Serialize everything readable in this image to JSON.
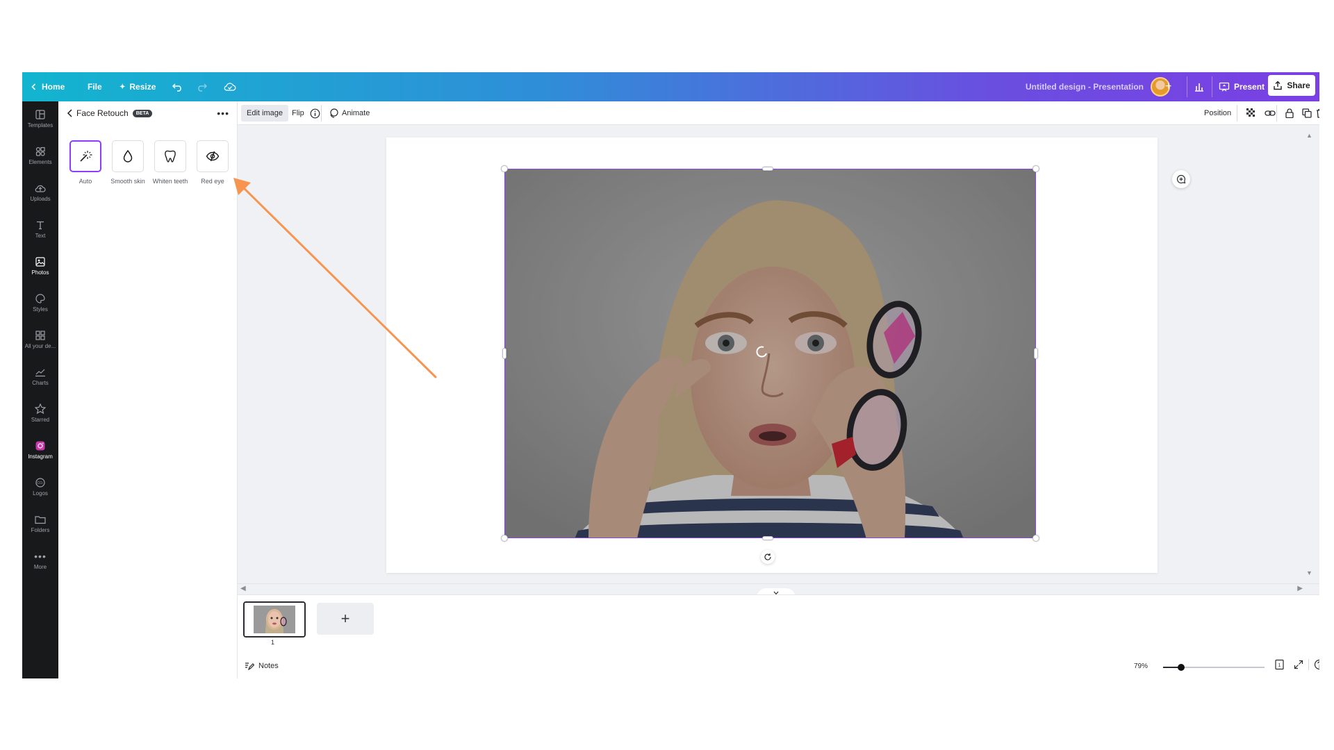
{
  "topbar": {
    "home": "Home",
    "file": "File",
    "resize": "Resize",
    "doc_title": "Untitled design - Presentation",
    "present": "Present",
    "share": "Share"
  },
  "rail": {
    "items": [
      {
        "label": "Templates",
        "icon": "templates-icon"
      },
      {
        "label": "Elements",
        "icon": "elements-icon"
      },
      {
        "label": "Uploads",
        "icon": "upload-cloud-icon"
      },
      {
        "label": "Text",
        "icon": "text-icon"
      },
      {
        "label": "Photos",
        "icon": "photos-icon"
      },
      {
        "label": "Styles",
        "icon": "palette-icon"
      },
      {
        "label": "All your de...",
        "icon": "grid-icon"
      },
      {
        "label": "Charts",
        "icon": "chart-icon"
      },
      {
        "label": "Starred",
        "icon": "star-icon"
      },
      {
        "label": "Instagram",
        "icon": "instagram-icon"
      },
      {
        "label": "Logos",
        "icon": "logo-icon"
      },
      {
        "label": "Folders",
        "icon": "folder-icon"
      },
      {
        "label": "More",
        "icon": "more-icon"
      }
    ],
    "active": "Photos"
  },
  "panel": {
    "title": "Face Retouch",
    "badge": "BETA",
    "tools": [
      {
        "label": "Auto",
        "icon": "magic-wand-icon"
      },
      {
        "label": "Smooth skin",
        "icon": "droplet-icon"
      },
      {
        "label": "Whiten teeth",
        "icon": "tooth-icon"
      },
      {
        "label": "Red eye",
        "icon": "eye-slash-icon"
      }
    ],
    "selected": "Auto"
  },
  "context_toolbar": {
    "edit_image": "Edit image",
    "flip": "Flip",
    "animate": "Animate",
    "position": "Position"
  },
  "strip": {
    "page_number": "1",
    "add_page": "+",
    "notes": "Notes",
    "zoom": "79%",
    "zoom_level": 0.18
  },
  "colors": {
    "accent": "#8b3dff",
    "annotation_arrow": "#f7944f",
    "rail_bg": "#18191b"
  }
}
